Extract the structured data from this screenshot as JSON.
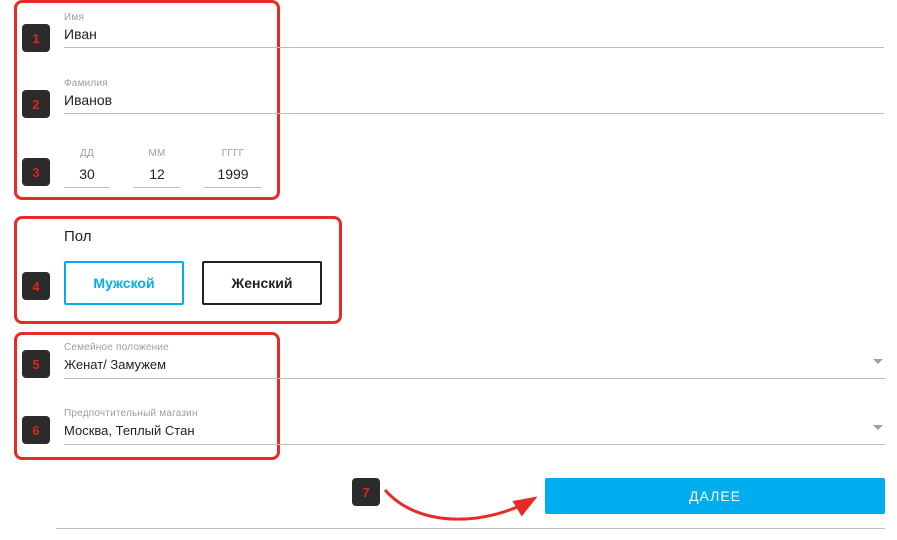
{
  "markers": {
    "m1": "1",
    "m2": "2",
    "m3": "3",
    "m4": "4",
    "m5": "5",
    "m6": "6",
    "m7": "7"
  },
  "name": {
    "label": "Имя",
    "value": "Иван"
  },
  "surname": {
    "label": "Фамилия",
    "value": "Иванов"
  },
  "dob": {
    "day_label": "ДД",
    "day_value": "30",
    "month_label": "ММ",
    "month_value": "12",
    "year_label": "ГГГГ",
    "year_value": "1999"
  },
  "gender": {
    "title": "Пол",
    "male": "Мужской",
    "female": "Женский"
  },
  "marital": {
    "label": "Семейное положение",
    "value": "Женат/ Замужем"
  },
  "store": {
    "label": "Предпочтительный магазин",
    "value": "Москва, Теплый Стан"
  },
  "next_button": "ДАЛЕЕ"
}
